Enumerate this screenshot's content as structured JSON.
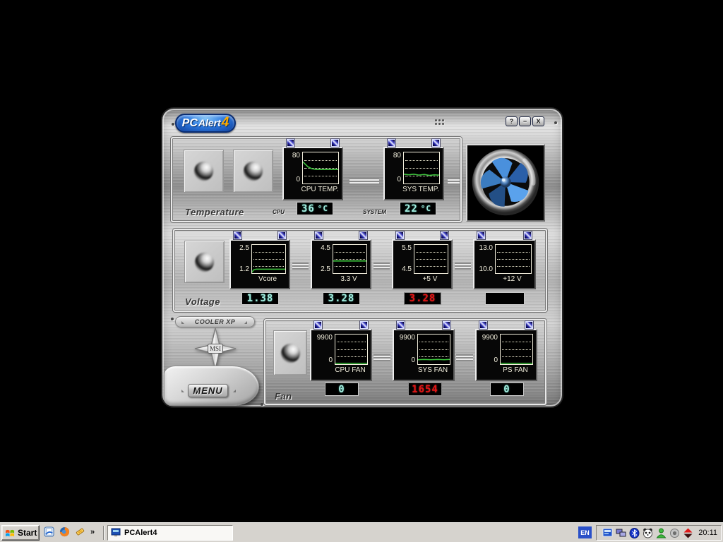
{
  "window": {
    "logo": {
      "pc": "PC",
      "alert": "Alert",
      "version": "4"
    },
    "controls": {
      "help": "?",
      "minimize": "−",
      "close": "X"
    }
  },
  "temperature": {
    "label": "Temperature",
    "cpu": {
      "y_max": "80",
      "y_min": "0",
      "graph_label": "CPU TEMP.",
      "trace": "0,30 6,37 14,46 24,52 38,55 55,55 100,55",
      "readout_label": "CPU",
      "value": "36",
      "unit": "°C"
    },
    "system": {
      "y_max": "80",
      "y_min": "0",
      "graph_label": "SYS TEMP.",
      "trace": "0,70 14,72 28,70 42,73 58,71 72,74 86,72 100,73",
      "readout_label": "SYSTEM",
      "value": "22",
      "unit": "°C"
    }
  },
  "voltage": {
    "label": "Voltage",
    "items": [
      {
        "graph_label": "Vcore",
        "y_max": "2.5",
        "y_min": "1.2",
        "value": "1.38",
        "alarm": false,
        "trace": "0,97 4,89 12,86 100,86"
      },
      {
        "graph_label": "3.3 V",
        "y_max": "4.5",
        "y_min": "2.5",
        "value": "3.28",
        "alarm": false,
        "trace": "0,57 100,57"
      },
      {
        "graph_label": "+5 V",
        "y_max": "5.5",
        "y_min": "4.5",
        "value": "3.28",
        "alarm": true,
        "trace": ""
      },
      {
        "graph_label": "+12 V",
        "y_max": "13.0",
        "y_min": "10.0",
        "value": "",
        "alarm": false,
        "trace": ""
      }
    ]
  },
  "fan": {
    "label": "Fan",
    "items": [
      {
        "graph_label": "CPU FAN",
        "y_max": "9900",
        "y_min": "0",
        "value": "0",
        "alarm": false,
        "trace": "0,97 100,97"
      },
      {
        "graph_label": "SYS FAN",
        "y_max": "9900",
        "y_min": "0",
        "value": "1654",
        "alarm": true,
        "trace": "0,85 20,84 40,85 62,84 82,85 100,84"
      },
      {
        "graph_label": "PS FAN",
        "y_max": "9900",
        "y_min": "0",
        "value": "0",
        "alarm": false,
        "trace": "0,97 100,97"
      }
    ]
  },
  "side": {
    "cooler_xp": "COOLER XP",
    "msi": "MSI",
    "menu": "MENU"
  },
  "taskbar": {
    "start": "Start",
    "quick_launch_overflow": "»",
    "task": "PCAlert4",
    "tray": {
      "language": "EN",
      "clock": "20:11"
    }
  },
  "colors": {
    "lcd_cyan": "#a2ecdf",
    "lcd_red": "#e41414",
    "trace_green": "#3ec43e",
    "gem_blue": "#2929b8",
    "logo_blue": "#1d5fc8",
    "logo_orange": "#ffac00"
  }
}
